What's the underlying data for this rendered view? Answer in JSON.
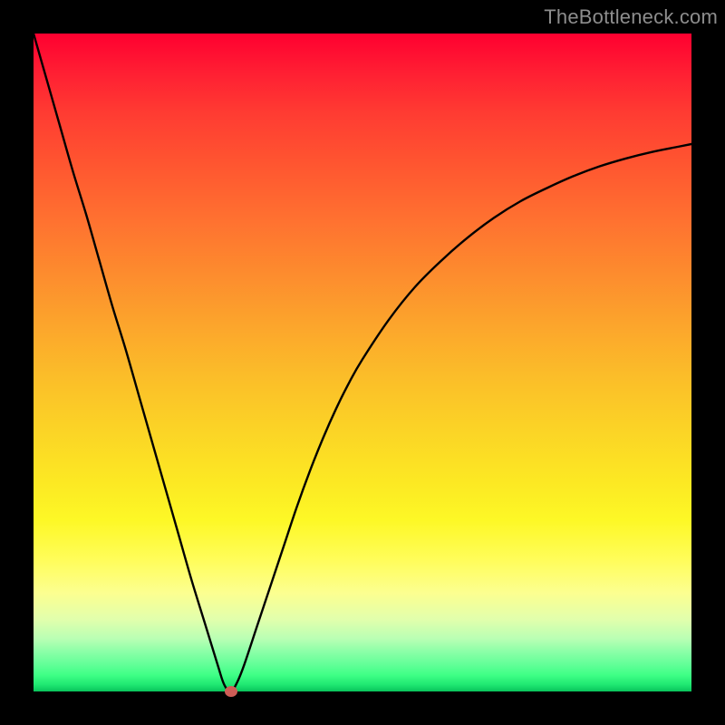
{
  "watermark": "TheBottleneck.com",
  "colors": {
    "frame": "#000000",
    "curve": "#000000",
    "marker": "#cd5d56"
  },
  "chart_data": {
    "type": "line",
    "title": "",
    "xlabel": "",
    "ylabel": "",
    "xlim": [
      0,
      100
    ],
    "ylim": [
      0,
      100
    ],
    "grid": false,
    "legend": false,
    "series": [
      {
        "name": "bottleneck-curve",
        "x": [
          0,
          2,
          4,
          6,
          8,
          10,
          12,
          14,
          16,
          18,
          20,
          22,
          24,
          26,
          28,
          29,
          30,
          31,
          32,
          34,
          36,
          38,
          40,
          42,
          44,
          46,
          48,
          50,
          54,
          58,
          62,
          66,
          70,
          74,
          78,
          82,
          86,
          90,
          94,
          98,
          100
        ],
        "y": [
          100,
          93,
          86,
          79,
          72.5,
          65.5,
          58.5,
          52,
          45,
          38,
          31,
          24,
          17,
          10.5,
          4,
          1,
          0,
          1.5,
          4,
          10,
          16,
          22,
          28,
          33.5,
          38.5,
          43,
          47,
          50.5,
          56.5,
          61.5,
          65.5,
          69,
          72,
          74.5,
          76.5,
          78.3,
          79.8,
          81,
          82,
          82.8,
          83.2
        ]
      }
    ],
    "marker": {
      "x": 30,
      "y": 0
    },
    "background_gradient": {
      "top": "#ff0030",
      "middle": "#fce823",
      "bottom": "#09c45b"
    }
  }
}
